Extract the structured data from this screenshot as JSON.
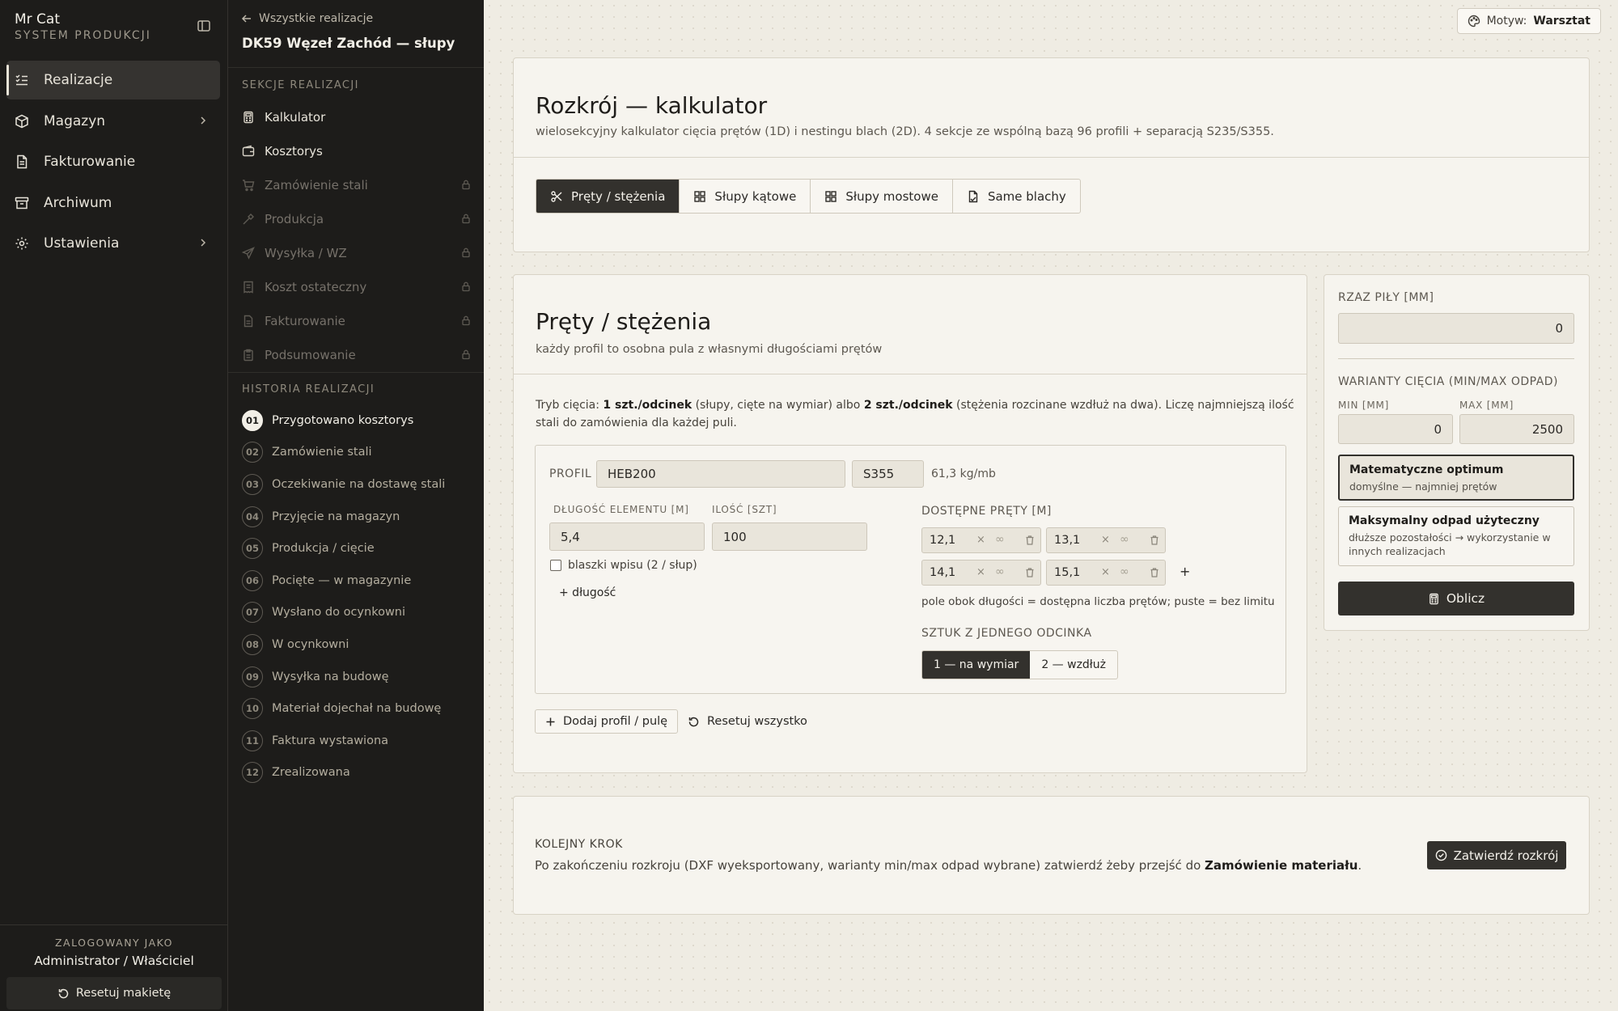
{
  "brand": {
    "name": "Mr Cat",
    "subtitle": "SYSTEM PRODUKCJI"
  },
  "nav": {
    "items": [
      {
        "label": "Realizacje"
      },
      {
        "label": "Magazyn"
      },
      {
        "label": "Fakturowanie"
      },
      {
        "label": "Archiwum"
      },
      {
        "label": "Ustawienia"
      }
    ]
  },
  "user": {
    "label": "ZALOGOWANY JAKO",
    "name": "Administrator / Właściciel",
    "reset_label": "Resetuj makietę"
  },
  "project": {
    "back_label": "Wszystkie realizacje",
    "title": "DK59 Węzeł Zachód — słupy",
    "sections_label": "SEKCJE REALIZACJI",
    "sections": [
      {
        "label": "Kalkulator"
      },
      {
        "label": "Kosztorys"
      },
      {
        "label": "Zamówienie stali"
      },
      {
        "label": "Produkcja"
      },
      {
        "label": "Wysyłka / WZ"
      },
      {
        "label": "Koszt ostateczny"
      },
      {
        "label": "Fakturowanie"
      },
      {
        "label": "Podsumowanie"
      }
    ],
    "history_label": "HISTORIA REALIZACJI",
    "history": [
      {
        "num": "01",
        "label": "Przygotowano kosztorys"
      },
      {
        "num": "02",
        "label": "Zamówienie stali"
      },
      {
        "num": "03",
        "label": "Oczekiwanie na dostawę stali"
      },
      {
        "num": "04",
        "label": "Przyjęcie na magazyn"
      },
      {
        "num": "05",
        "label": "Produkcja / cięcie"
      },
      {
        "num": "06",
        "label": "Pocięte — w magazynie"
      },
      {
        "num": "07",
        "label": "Wysłano do ocynkowni"
      },
      {
        "num": "08",
        "label": "W ocynkowni"
      },
      {
        "num": "09",
        "label": "Wysyłka na budowę"
      },
      {
        "num": "10",
        "label": "Materiał dojechał na budowę"
      },
      {
        "num": "11",
        "label": "Faktura wystawiona"
      },
      {
        "num": "12",
        "label": "Zrealizowana"
      }
    ]
  },
  "theme": {
    "label": "Motyw:",
    "value": "Warsztat"
  },
  "header": {
    "title": "Rozkrój — kalkulator",
    "subtitle": "wielosekcyjny kalkulator cięcia prętów (1D) i nestingu blach (2D). 4 sekcje ze wspólną bazą 96 profili + separacją S235/S355.",
    "tabs": [
      {
        "label": "Pręty / stężenia"
      },
      {
        "label": "Słupy kątowe"
      },
      {
        "label": "Słupy mostowe"
      },
      {
        "label": "Same blachy"
      }
    ]
  },
  "section": {
    "title": "Pręty / stężenia",
    "subtitle": "każdy profil to osobna pula z własnymi długościami prętów",
    "mode_prefix": "Tryb cięcia: ",
    "mode_opt1": "1 szt./odcinek",
    "mode_mid": " (słupy, cięte na wymiar) albo ",
    "mode_opt2": "2 szt./odcinek",
    "mode_suffix": " (stężenia rozcinane wzdłuż na dwa). Liczę najmniejszą ilość stali do zamówienia dla każdej puli."
  },
  "pool": {
    "profile_label": "PROFIL",
    "profile_value": "HEB200",
    "grade_value": "S355",
    "weight": "61,3 kg/mb",
    "length_label": "DŁUGOŚĆ ELEMENTU [M]",
    "length_value": "5,4",
    "qty_label": "ILOŚĆ [SZT]",
    "qty_value": "100",
    "checkbox_label": "blaszki wpisu (2 / słup)",
    "add_length": "+ długość",
    "bars_label": "DOSTĘPNE PRĘTY [M]",
    "bars": [
      {
        "value": "12,1",
        "x": "×",
        "limit": "∞"
      },
      {
        "value": "13,1",
        "x": "×",
        "limit": "∞"
      },
      {
        "value": "14,1",
        "x": "×",
        "limit": "∞"
      },
      {
        "value": "15,1",
        "x": "×",
        "limit": "∞"
      }
    ],
    "add_bar": "+",
    "bars_hint": "pole obok długości = dostępna liczba prętów; puste = bez limitu",
    "pieces_label": "SZTUK Z JEDNEGO ODCINKA",
    "pieces_options": [
      "1 — na wymiar",
      "2 — wzdłuż"
    ]
  },
  "actions": {
    "add_pool": "Dodaj profil / pulę",
    "reset_all": "Resetuj wszystko"
  },
  "settings": {
    "kerf_label": "RZAZ PIŁY [MM]",
    "kerf_value": "0",
    "variants_label": "WARIANTY CIĘCIA (MIN/MAX ODPAD)",
    "min_label": "MIN [MM]",
    "min_value": "0",
    "max_label": "MAX [MM]",
    "max_value": "2500",
    "option1_title": "Matematyczne optimum",
    "option1_desc": "domyślne — najmniej prętów",
    "option2_title": "Maksymalny odpad użyteczny",
    "option2_desc": "dłuższe pozostałości → wykorzystanie w innych realizacjach",
    "compute_label": "Oblicz"
  },
  "next_step": {
    "label": "KOLEJNY KROK",
    "text_prefix": "Po zakończeniu rozkroju (DXF wyeksportowany, warianty min/max odpad wybrane) zatwierdź żeby przejść do ",
    "text_link": "Zamówienie materiału",
    "text_suffix": ".",
    "confirm_label": "Zatwierdź rozkrój"
  }
}
